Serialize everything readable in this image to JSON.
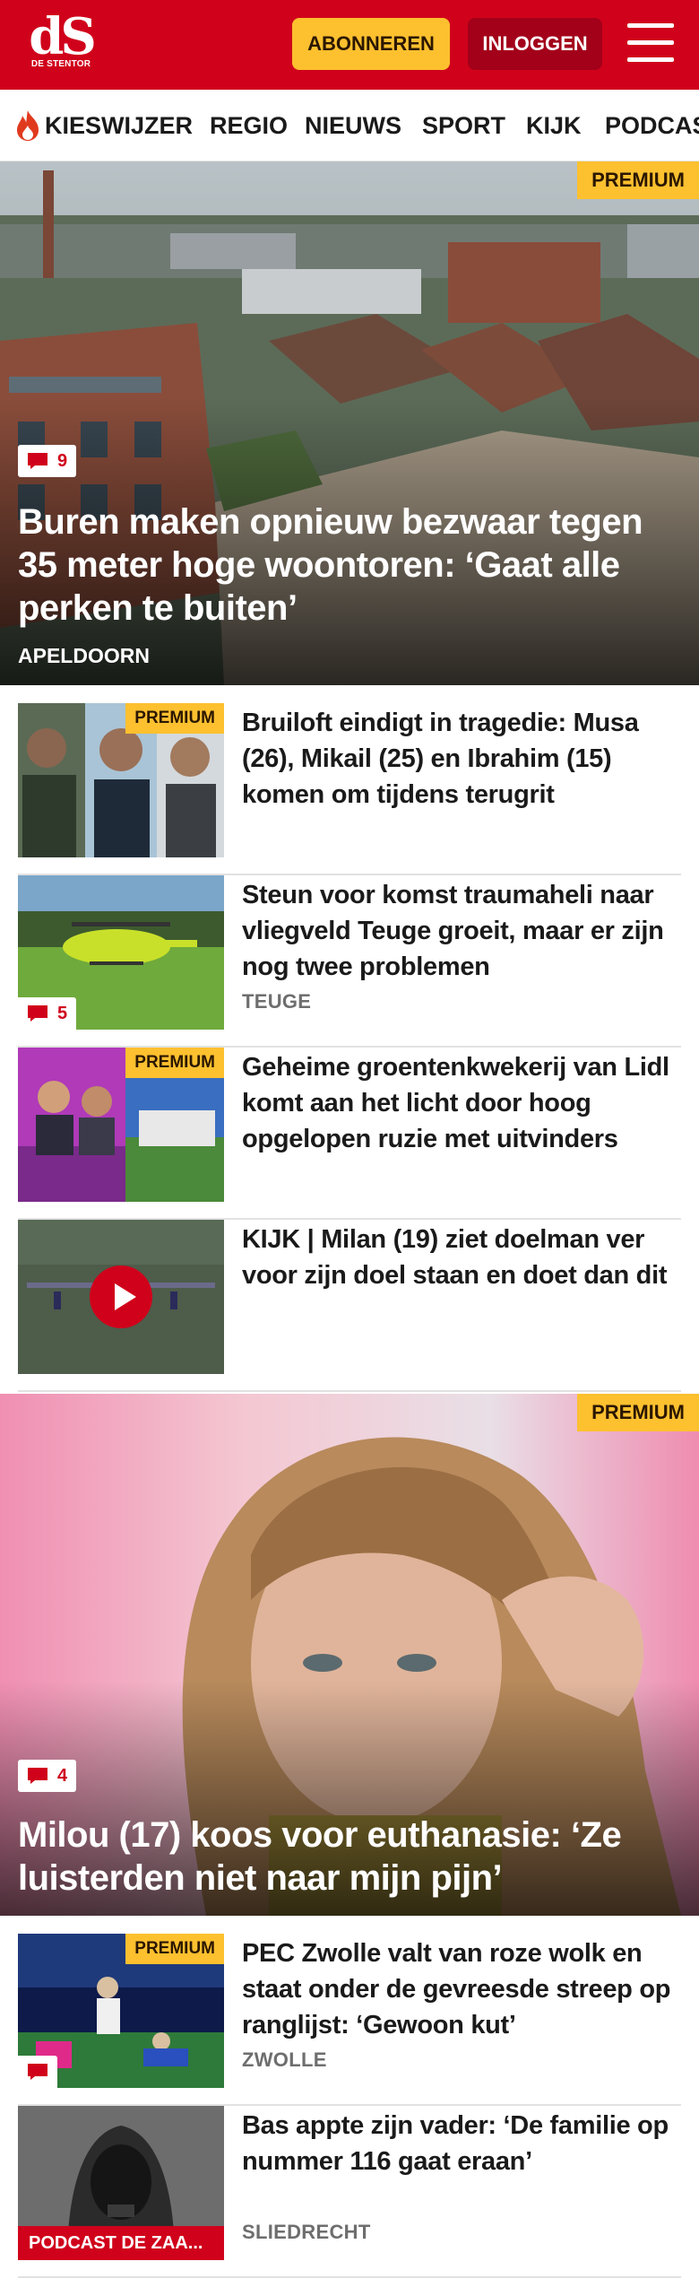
{
  "header": {
    "logo_text": "dS",
    "logo_subtitle": "DE STENTOR",
    "subscribe_label": "ABONNEREN",
    "login_label": "INLOGGEN",
    "menu_icon": "hamburger-menu-icon"
  },
  "nav": {
    "items": [
      {
        "label": "KIESWIJZER",
        "icon": "flame-icon"
      },
      {
        "label": "REGIO"
      },
      {
        "label": "NIEUWS"
      },
      {
        "label": "SPORT"
      },
      {
        "label": "KIJK"
      },
      {
        "label": "PODCASTS"
      }
    ]
  },
  "colors": {
    "brand_red": "#d0021b",
    "premium_yellow": "#fdc02f",
    "login_dark_red": "#a3001a"
  },
  "articles": [
    {
      "kind": "hero",
      "premium": "PREMIUM",
      "comments": "9",
      "title": "Buren maken opnieuw bezwaar tegen 35 meter hoge woontoren: ‘Gaat alle perken te buiten’",
      "label": "APELDOORN"
    },
    {
      "kind": "list",
      "premium": "PREMIUM",
      "title": "Bruiloft eindigt in tragedie: Musa (26), Mikail (25) en Ibrahim (15) komen om tijdens terugrit"
    },
    {
      "kind": "list",
      "comments": "5",
      "title": "Steun voor komst traumaheli naar vliegveld Teuge groeit, maar er zijn nog twee problemen",
      "label": "TEUGE"
    },
    {
      "kind": "list",
      "premium": "PREMIUM",
      "title": "Geheime groentenkwekerij van Lidl komt aan het licht door hoog opgelopen ruzie met uitvinders"
    },
    {
      "kind": "list",
      "video": true,
      "title": "KIJK | Milan (19) ziet doelman ver voor zijn doel staan en doet dan dit"
    },
    {
      "kind": "hero",
      "premium": "PREMIUM",
      "comments": "4",
      "title": "Milou (17) koos voor euthanasie: ‘Ze luisterden niet naar mijn pijn’"
    },
    {
      "kind": "list",
      "premium": "PREMIUM",
      "comments_icon_only": true,
      "title": "PEC Zwolle valt van roze wolk en staat onder de gevreesde streep op ranglijst: ‘Gewoon kut’",
      "label": "ZWOLLE"
    },
    {
      "kind": "list",
      "podcast_label": "PODCAST DE ZAA...",
      "title": "Bas appte zijn vader: ‘De familie op nummer 116 gaat eraan’",
      "label": "SLIEDRECHT"
    }
  ]
}
